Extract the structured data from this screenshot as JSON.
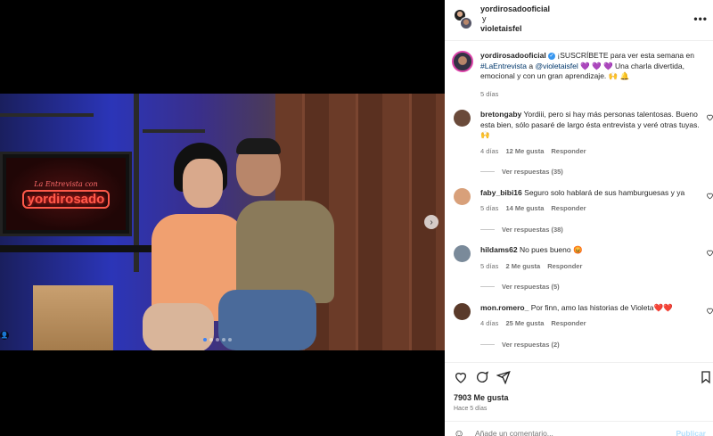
{
  "media": {
    "tv_logo_top": "La Entrevista con",
    "tv_logo": "yordirosado",
    "next_glyph": "›",
    "tag_glyph": "👤",
    "carousel": {
      "count": 5,
      "active_index": 0
    }
  },
  "header": {
    "user1": "yordirosadooficial",
    "joiner": "y",
    "user2": "violetaisfel",
    "more": "•••"
  },
  "caption": {
    "user": "yordirosadooficial",
    "verified": "✓",
    "text_part1": " ¡SUSCRÍBETE para ver esta semana en ",
    "hashtag": "#LaEntrevista",
    "text_part2": " a ",
    "mention": "@violetaisfel",
    "hearts": " 💜 💜 💜",
    "text_part3": " Una charla divertida, emocional y con un gran aprendizaje. 🙌 🔔",
    "time": "5 días"
  },
  "comments": [
    {
      "user": "bretongaby",
      "text": "Yordiii, pero si hay más personas talentosas. Bueno esta bien, sólo pasaré de largo ésta entrevista y veré otras tuyas.🙌",
      "time": "4 días",
      "likes": "12 Me gusta",
      "reply": "Responder",
      "replies": "Ver respuestas (35)",
      "avatar_color": "#6a4a3a"
    },
    {
      "user": "faby_bibi16",
      "text": "Seguro solo hablará de sus hamburguesas y ya",
      "time": "5 días",
      "likes": "14 Me gusta",
      "reply": "Responder",
      "replies": "Ver respuestas (38)",
      "avatar_color": "#d8a07a"
    },
    {
      "user": "hildams62",
      "text": "No pues bueno 😡",
      "time": "5 días",
      "likes": "2 Me gusta",
      "reply": "Responder",
      "replies": "Ver respuestas (5)",
      "avatar_color": "#7a8a9a"
    },
    {
      "user": "mon.romero_",
      "text": "Por finn, amo las historias de Violeta❤️❤️",
      "time": "4 días",
      "likes": "25 Me gusta",
      "reply": "Responder",
      "replies": "Ver respuestas (2)",
      "avatar_color": "#5a3a2a"
    }
  ],
  "actions": {
    "like_icon": "heart-icon",
    "comment_icon": "comment-icon",
    "share_icon": "share-icon",
    "save_icon": "bookmark-icon"
  },
  "likes_count": "7903 Me gusta",
  "posted_ago": "Hace 5 días",
  "add_comment": {
    "placeholder": "Añade un comentario...",
    "publish": "Publicar"
  }
}
